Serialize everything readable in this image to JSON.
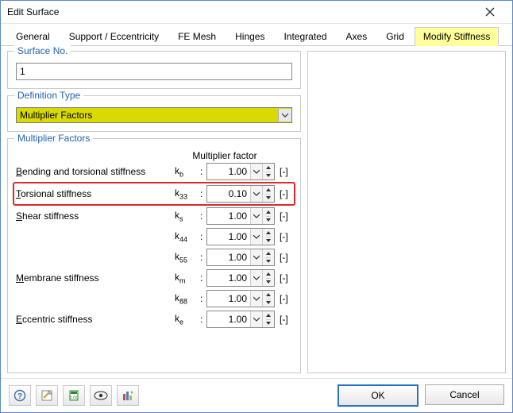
{
  "window": {
    "title": "Edit Surface"
  },
  "tabs": {
    "items": [
      {
        "label": "General"
      },
      {
        "label": "Support / Eccentricity"
      },
      {
        "label": "FE Mesh"
      },
      {
        "label": "Hinges"
      },
      {
        "label": "Integrated"
      },
      {
        "label": "Axes"
      },
      {
        "label": "Grid"
      },
      {
        "label": "Modify Stiffness"
      }
    ],
    "active_index": 7
  },
  "surface_no": {
    "legend": "Surface No.",
    "value": "1"
  },
  "definition_type": {
    "legend": "Definition Type",
    "value": "Multiplier Factors"
  },
  "multiplier_factors": {
    "legend": "Multiplier Factors",
    "header": "Multiplier factor",
    "rows": [
      {
        "label": "Bending and torsional stiffness",
        "ul": "B",
        "sym": "k",
        "sub": "b",
        "value": "1.00",
        "unit": "[-]",
        "hl": false
      },
      {
        "label": "Torsional stiffness",
        "ul": "T",
        "sym": "k",
        "sub": "33",
        "value": "0.10",
        "unit": "[-]",
        "hl": true
      },
      {
        "label": "Shear stiffness",
        "ul": "S",
        "sym": "k",
        "sub": "s",
        "value": "1.00",
        "unit": "[-]",
        "hl": false
      },
      {
        "label": "",
        "ul": "",
        "sym": "k",
        "sub": "44",
        "value": "1.00",
        "unit": "[-]",
        "hl": false
      },
      {
        "label": "",
        "ul": "",
        "sym": "k",
        "sub": "55",
        "value": "1.00",
        "unit": "[-]",
        "hl": false
      },
      {
        "label": "Membrane stiffness",
        "ul": "M",
        "sym": "k",
        "sub": "m",
        "value": "1.00",
        "unit": "[-]",
        "hl": false
      },
      {
        "label": "",
        "ul": "",
        "sym": "k",
        "sub": "88",
        "value": "1.00",
        "unit": "[-]",
        "hl": false
      },
      {
        "label": "Eccentric stiffness",
        "ul": "E",
        "sym": "k",
        "sub": "e",
        "value": "1.00",
        "unit": "[-]",
        "hl": false
      }
    ]
  },
  "footer": {
    "ok": "OK",
    "cancel": "Cancel"
  },
  "icons": {
    "help": "help-icon",
    "note": "note-icon",
    "calc": "calc-icon",
    "eye": "eye-icon",
    "anim": "anim-icon"
  }
}
